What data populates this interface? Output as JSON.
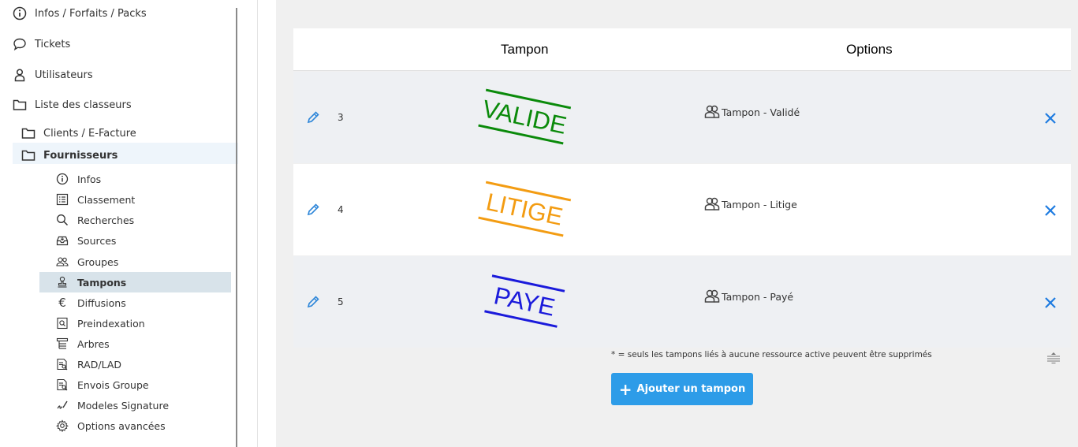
{
  "sidebar": {
    "top_items": [
      {
        "label": "Infos / Forfaits / Packs",
        "icon": "info-circle-icon"
      },
      {
        "label": "Tickets",
        "icon": "speech-bubble-icon"
      },
      {
        "label": "Utilisateurs",
        "icon": "user-icon"
      },
      {
        "label": "Liste des classeurs",
        "icon": "folder-icon"
      }
    ],
    "folders": [
      {
        "label": "Clients / E-Facture",
        "icon": "folder-icon"
      },
      {
        "label": "Fournisseurs",
        "icon": "folder-icon",
        "selected": true
      }
    ],
    "sub_items": [
      {
        "label": "Infos",
        "icon": "info-circle-icon"
      },
      {
        "label": "Classement",
        "icon": "list-icon"
      },
      {
        "label": "Recherches",
        "icon": "search-icon"
      },
      {
        "label": "Sources",
        "icon": "inbox-icon"
      },
      {
        "label": "Groupes",
        "icon": "users-icon"
      },
      {
        "label": "Tampons",
        "icon": "stamp-icon",
        "active": true
      },
      {
        "label": "Diffusions",
        "icon": "euro-icon"
      },
      {
        "label": "Preindexation",
        "icon": "document-search-icon"
      },
      {
        "label": "Arbres",
        "icon": "tree-icon"
      },
      {
        "label": "RAD/LAD",
        "icon": "document-scan-icon"
      },
      {
        "label": "Envois Groupe",
        "icon": "document-send-icon"
      },
      {
        "label": "Modeles Signature",
        "icon": "signature-icon"
      },
      {
        "label": "Options avancées",
        "icon": "gear-icon"
      }
    ]
  },
  "table": {
    "headers": {
      "stamp": "Tampon",
      "options": "Options"
    },
    "rows": [
      {
        "id": "3",
        "stamp_text": "VALIDE",
        "stamp_color": "#0a8a0a",
        "option": "Tampon - Validé",
        "bg": "#eef0f3"
      },
      {
        "id": "4",
        "stamp_text": "LITIGE",
        "stamp_color": "#f39c12",
        "option": "Tampon - Litige",
        "bg": "#ffffff"
      },
      {
        "id": "5",
        "stamp_text": "PAYE",
        "stamp_color": "#1a1adb",
        "option": "Tampon - Payé",
        "bg": "#eef0f3"
      }
    ]
  },
  "footnote": "* = seuls les tampons liés à aucune ressource active peuvent être supprimés",
  "add_button": {
    "label": "Ajouter un tampon",
    "icon": "plus-icon"
  },
  "colors": {
    "accent": "#2d9ce8",
    "delete": "#1e7be0",
    "edit": "#2d86d9"
  }
}
